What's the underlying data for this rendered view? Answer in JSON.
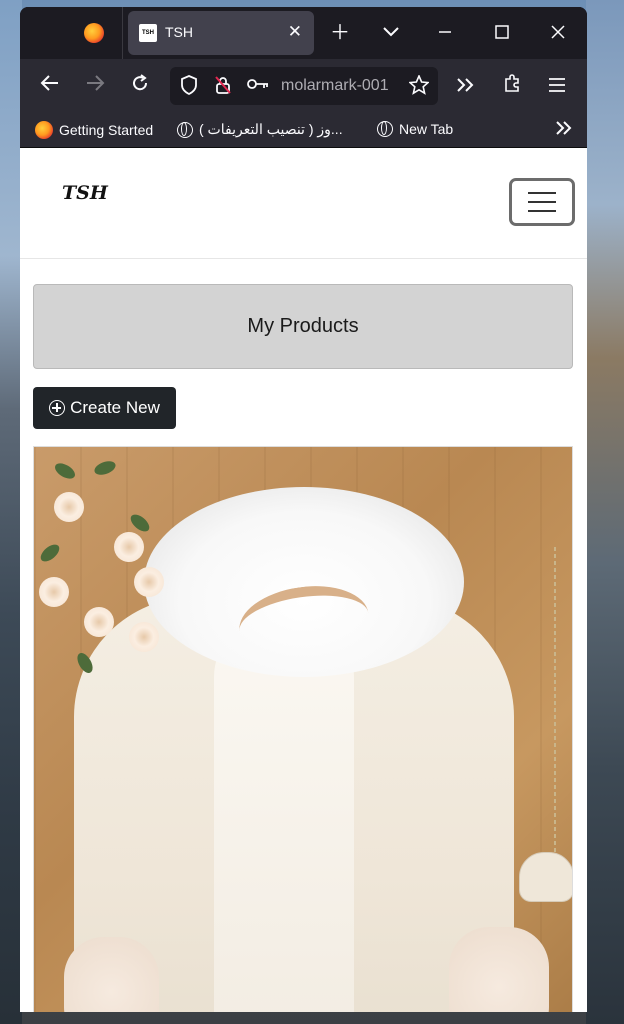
{
  "browser": {
    "tab": {
      "favicon_text": "TSH",
      "title": "TSH"
    },
    "url_text": "molarmark-001",
    "bookmarks": [
      {
        "label": "Getting Started",
        "icon": "firefox-icon"
      },
      {
        "label": "...وز ( تنصيب التعريفات )",
        "icon": "globe-icon"
      },
      {
        "label": "New Tab",
        "icon": "globe-icon"
      }
    ]
  },
  "site": {
    "brand": "TSH",
    "page_title": "My Products",
    "create_button_label": "Create New"
  }
}
